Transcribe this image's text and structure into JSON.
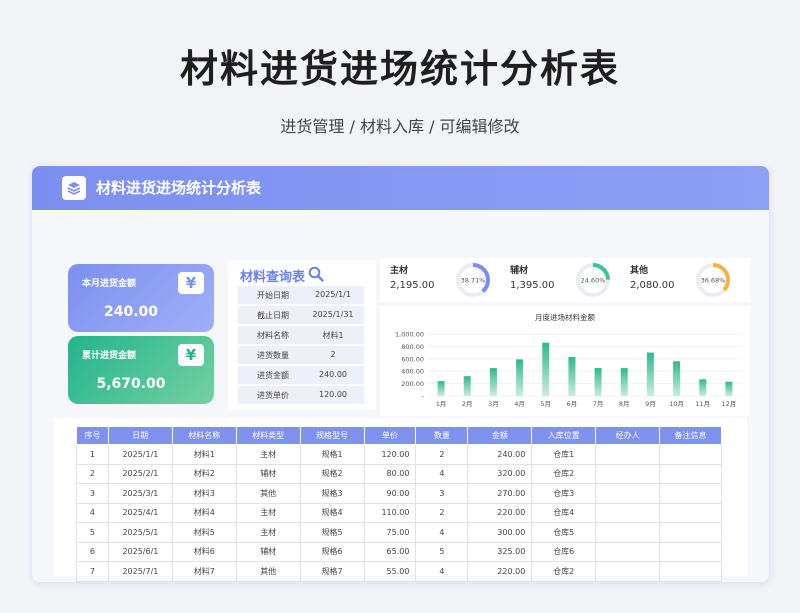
{
  "page": {
    "title": "材料进货进场统计分析表",
    "subtitle": "进货管理 / 材料入库 / 可编辑修改"
  },
  "header": {
    "title": "材料进货进场统计分析表",
    "icon": "layers-icon",
    "color": "#7c8ff0"
  },
  "stats": [
    {
      "label": "本月进货金额",
      "value": "240.00",
      "icon": "yen-icon",
      "color": "#7d8ff0"
    },
    {
      "label": "累计进货金额",
      "value": "5,670.00",
      "icon": "yen-icon",
      "color": "#22b48c"
    }
  ],
  "query": {
    "title": "材料查询表",
    "icon": "search-icon",
    "rows": [
      {
        "key": "开始日期",
        "value": "2025/1/1"
      },
      {
        "key": "截止日期",
        "value": "2025/1/31"
      },
      {
        "key": "材料名称",
        "value": "材料1"
      },
      {
        "key": "进货数量",
        "value": "2"
      },
      {
        "key": "进货金额",
        "value": "240.00"
      },
      {
        "key": "进货单价",
        "value": "120.00"
      }
    ]
  },
  "kpis": [
    {
      "name": "主材",
      "amount": "2,195.00",
      "percent_label": "38.71%",
      "percent": 0.3871,
      "color": "#7b8df0"
    },
    {
      "name": "辅材",
      "amount": "1,395.00",
      "percent_label": "24.60%",
      "percent": 0.246,
      "color": "#3ec293"
    },
    {
      "name": "其他",
      "amount": "2,080.00",
      "percent_label": "36.68%",
      "percent": 0.3668,
      "color": "#f3b33d"
    }
  ],
  "chart_data": {
    "type": "bar",
    "title": "月度进场材料金额",
    "categories": [
      "1月",
      "2月",
      "3月",
      "4月",
      "5月",
      "6月",
      "7月",
      "8月",
      "9月",
      "10月",
      "11月",
      "12月"
    ],
    "values": [
      240,
      320,
      450,
      590,
      860,
      630,
      450,
      450,
      700,
      560,
      270,
      230
    ],
    "y_ticks": [
      "1,000.00",
      "800.00",
      "600.00",
      "400.00",
      "200.00",
      "-"
    ],
    "ylim": [
      0,
      1000
    ],
    "grid": true,
    "colors": [
      "#2eba8a",
      "#c8eedd"
    ]
  },
  "table": {
    "headers": [
      "序号",
      "日期",
      "材料名称",
      "材料类型",
      "规格型号",
      "单价",
      "数量",
      "金额",
      "入库位置",
      "经办人",
      "备注信息"
    ],
    "rows": [
      [
        "1",
        "2025/1/1",
        "材料1",
        "主材",
        "规格1",
        "120.00",
        "2",
        "240.00",
        "仓库1",
        "",
        ""
      ],
      [
        "2",
        "2025/2/1",
        "材料2",
        "辅材",
        "规格2",
        "80.00",
        "4",
        "320.00",
        "仓库2",
        "",
        ""
      ],
      [
        "3",
        "2025/3/1",
        "材料3",
        "其他",
        "规格3",
        "90.00",
        "3",
        "270.00",
        "仓库3",
        "",
        ""
      ],
      [
        "4",
        "2025/4/1",
        "材料4",
        "主材",
        "规格4",
        "110.00",
        "2",
        "220.00",
        "仓库4",
        "",
        ""
      ],
      [
        "5",
        "2025/5/1",
        "材料5",
        "主材",
        "规格5",
        "75.00",
        "4",
        "300.00",
        "仓库5",
        "",
        ""
      ],
      [
        "6",
        "2025/6/1",
        "材料6",
        "辅材",
        "规格6",
        "65.00",
        "5",
        "325.00",
        "仓库6",
        "",
        ""
      ],
      [
        "7",
        "2025/7/1",
        "材料7",
        "其他",
        "规格7",
        "55.00",
        "4",
        "220.00",
        "仓库2",
        "",
        ""
      ]
    ]
  }
}
